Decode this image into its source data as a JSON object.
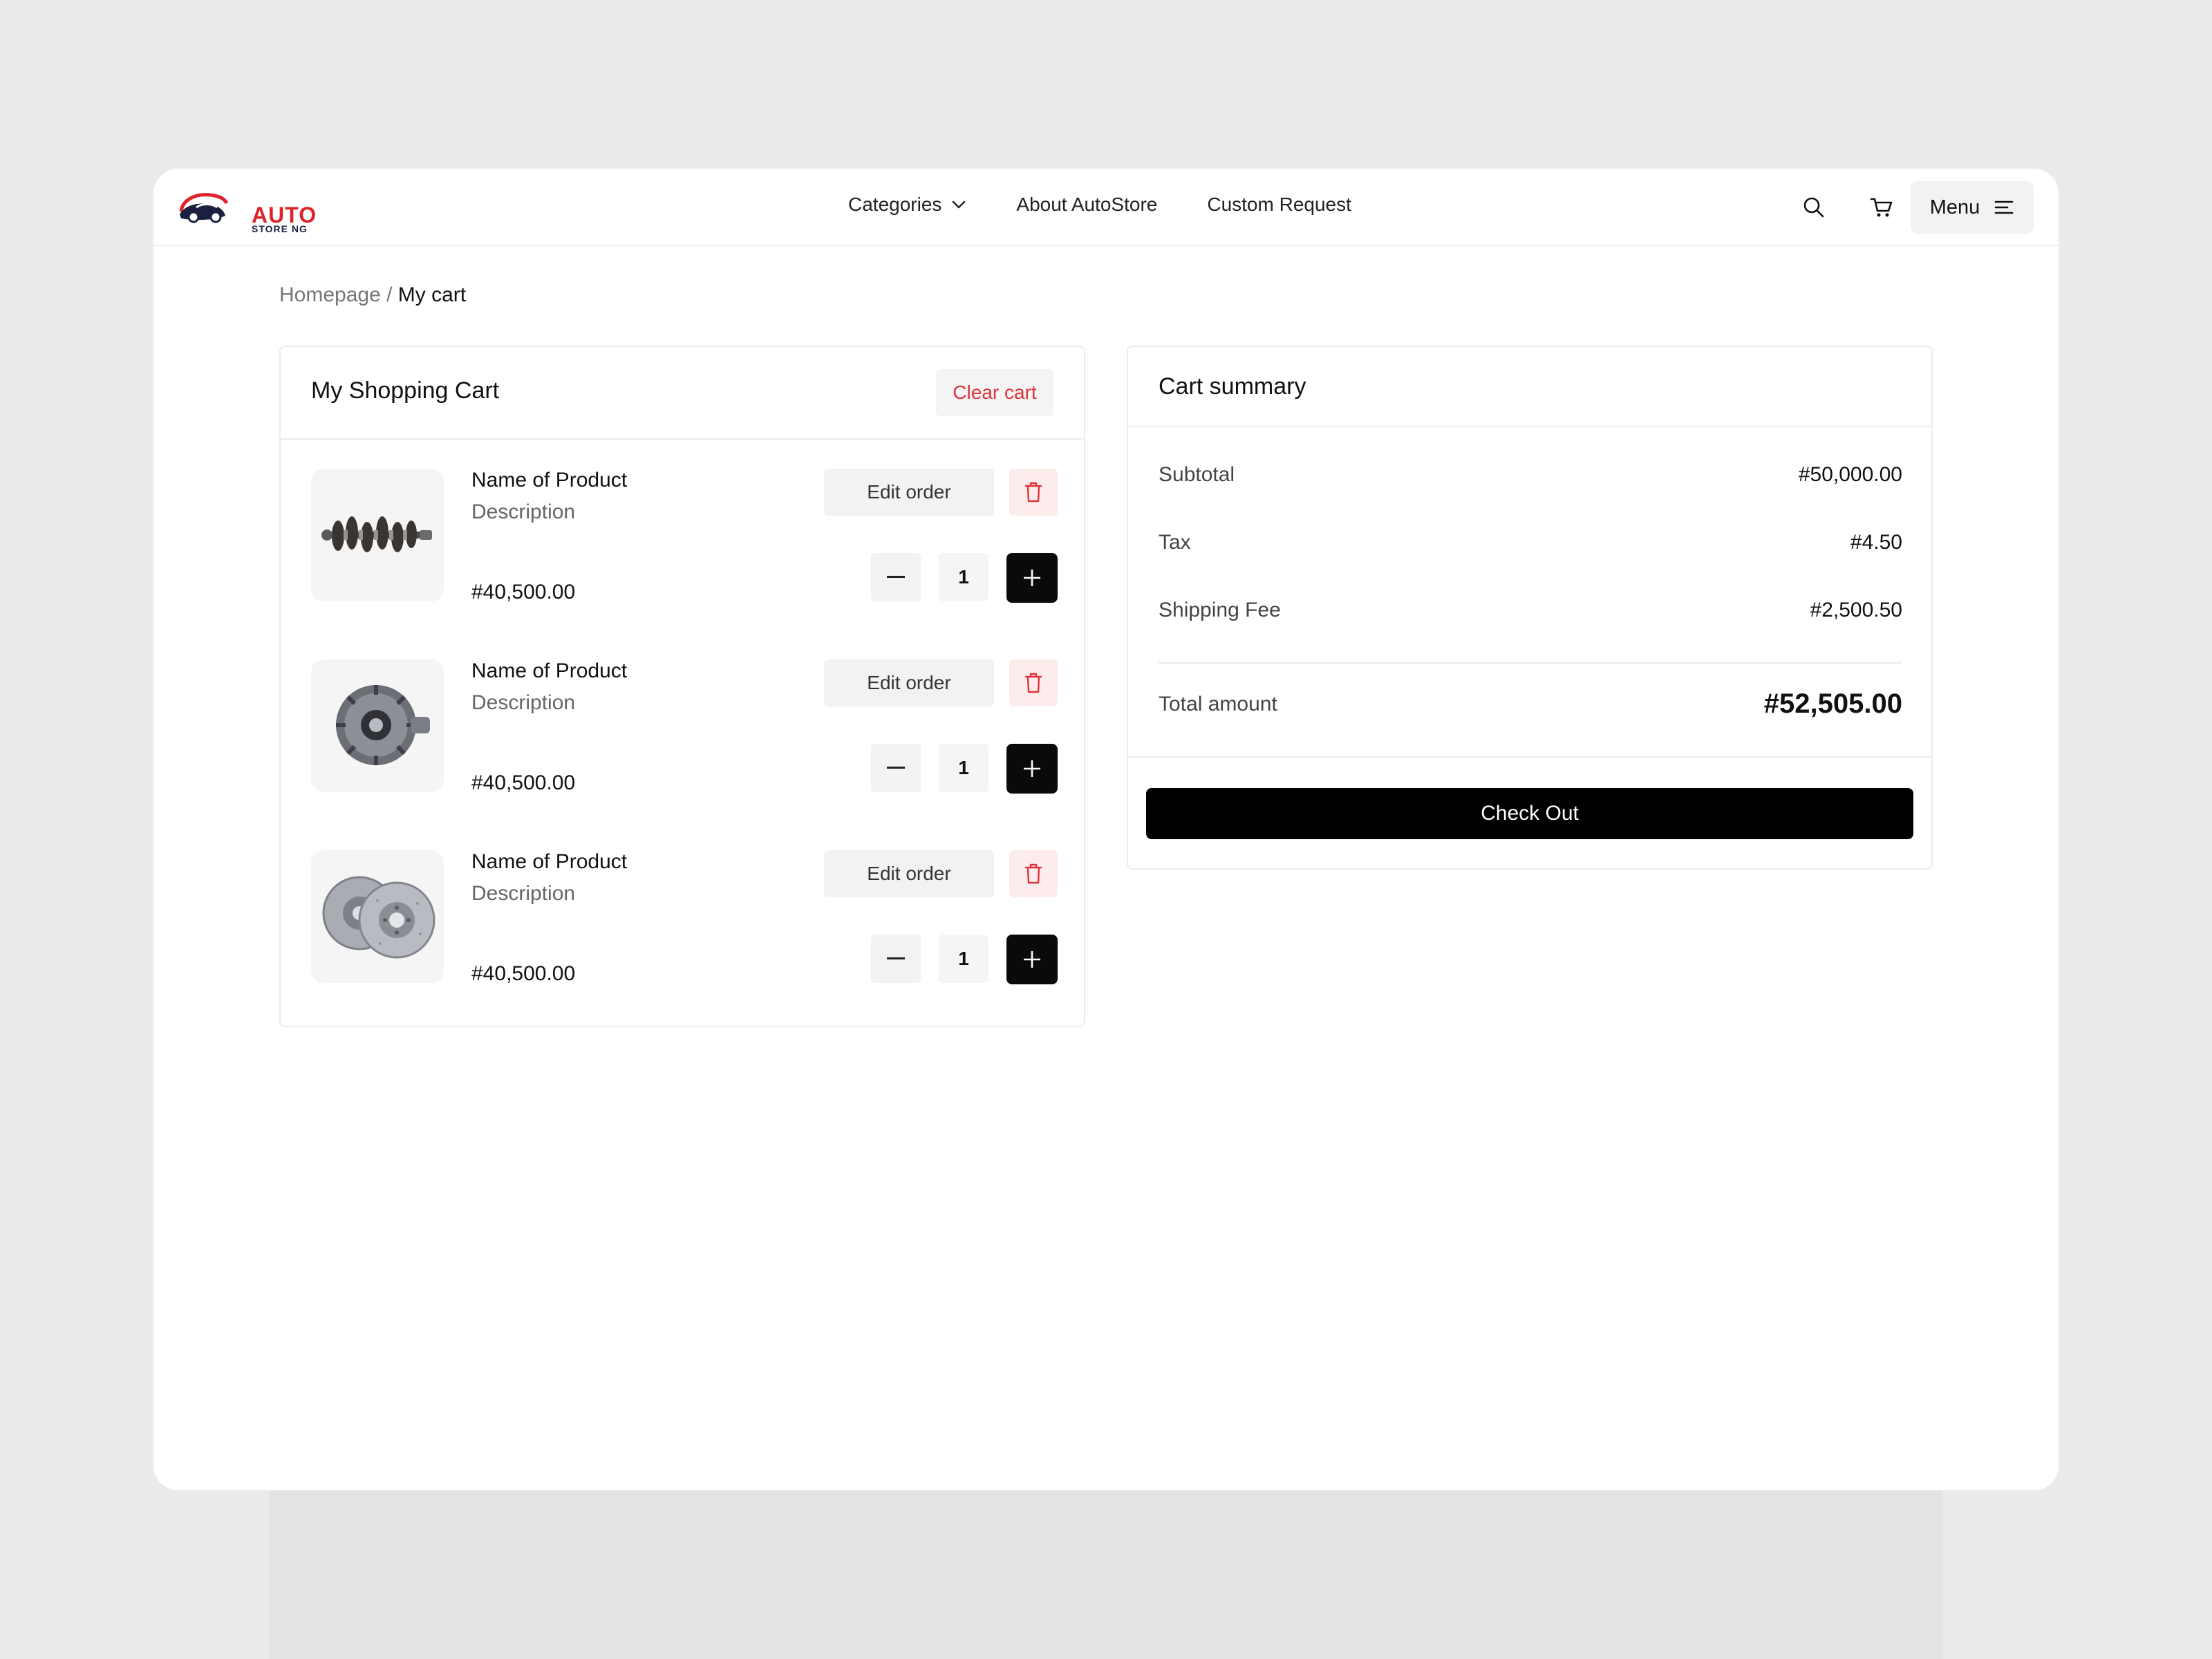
{
  "brand": {
    "name_main": "AUTO",
    "name_sub": "STORE NG"
  },
  "nav": {
    "categories": "Categories",
    "about": "About AutoStore",
    "custom": "Custom Request",
    "menu": "Menu"
  },
  "breadcrumb": {
    "home": "Homepage",
    "separator": " / ",
    "current": "My cart"
  },
  "cart": {
    "title": "My Shopping Cart",
    "clear_label": "Clear cart",
    "items": [
      {
        "name": "Name of Product",
        "description": "Description",
        "price": "#40,500.00",
        "qty": "1",
        "edit_label": "Edit order",
        "image": "crankshaft"
      },
      {
        "name": "Name of Product",
        "description": "Description",
        "price": "#40,500.00",
        "qty": "1",
        "edit_label": "Edit order",
        "image": "differential"
      },
      {
        "name": "Name of Product",
        "description": "Description",
        "price": "#40,500.00",
        "qty": "1",
        "edit_label": "Edit order",
        "image": "brake-discs"
      }
    ]
  },
  "summary": {
    "title": "Cart summary",
    "subtotal_label": "Subtotal",
    "subtotal": "#50,000.00",
    "tax_label": "Tax",
    "tax": "#4.50",
    "shipping_label": "Shipping Fee",
    "shipping": "#2,500.50",
    "total_label": "Total amount",
    "total": "#52,505.00",
    "checkout_label": "Check Out"
  },
  "colors": {
    "accent": "#e0222b",
    "primary": "#000000",
    "background": "#ebebeb"
  }
}
